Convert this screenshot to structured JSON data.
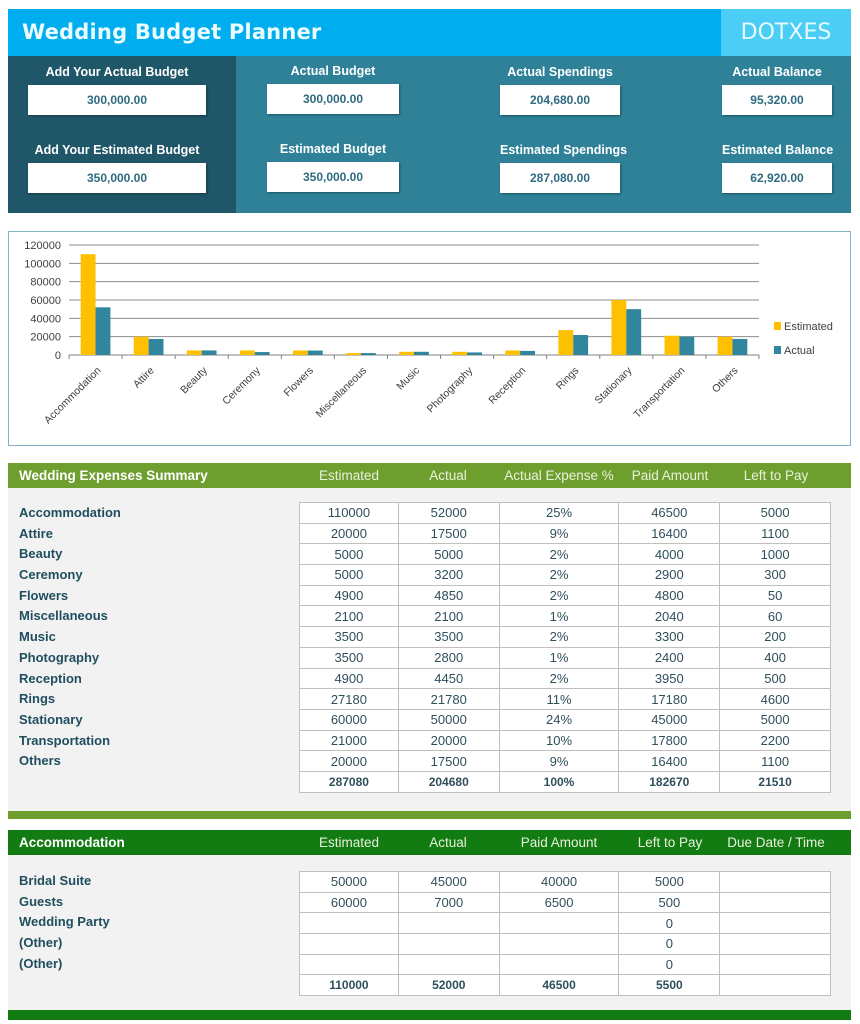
{
  "header": {
    "title": "Wedding Budget Planner",
    "brand": "DOTXES",
    "colors": {
      "title_bg": "#00aeef",
      "brand_bg": "#4ccdf5",
      "kpi_bg": "#2e8197",
      "input_bg": "#1f5668"
    }
  },
  "inputs": {
    "actual_budget_label": "Add Your Actual Budget",
    "actual_budget_value": "300,000.00",
    "estimated_budget_label": "Add Your Estimated Budget",
    "estimated_budget_value": "350,000.00"
  },
  "kpis": [
    {
      "label": "Actual Budget",
      "value": "300,000.00"
    },
    {
      "label": "Estimated Budget",
      "value": "350,000.00"
    },
    {
      "label": "Actual Spendings",
      "value": "204,680.00"
    },
    {
      "label": "Estimated Spendings",
      "value": "287,080.00"
    },
    {
      "label": "Actual Balance",
      "value": "95,320.00"
    },
    {
      "label": "Estimated Balance",
      "value": "62,920.00"
    }
  ],
  "chart_data": {
    "type": "bar",
    "title": "",
    "xlabel": "",
    "ylabel": "",
    "categories": [
      "Accommodation",
      "Attire",
      "Beauty",
      "Ceremony",
      "Flowers",
      "Miscellaneous",
      "Music",
      "Photography",
      "Reception",
      "Rings",
      "Stationary",
      "Transportation",
      "Others"
    ],
    "series": [
      {
        "name": "Estimated",
        "color": "#ffc000",
        "values": [
          110000,
          20000,
          5000,
          5000,
          4900,
          2100,
          3500,
          3500,
          4900,
          27180,
          60000,
          21000,
          20000
        ]
      },
      {
        "name": "Actual",
        "color": "#31859c",
        "values": [
          52000,
          17500,
          5000,
          3200,
          4850,
          2100,
          3500,
          2800,
          4450,
          21780,
          50000,
          20000,
          17500
        ]
      }
    ],
    "ylim": [
      0,
      120000
    ],
    "yticks": [
      "0",
      "20000",
      "40000",
      "60000",
      "80000",
      "100000",
      "120000"
    ],
    "grid": true,
    "legend": "right"
  },
  "summary": {
    "title": "Wedding Expenses Summary",
    "header_color": "#6e9e2e",
    "columns": [
      "Estimated",
      "Actual",
      "Actual Expense %",
      "Paid Amount",
      "Left to Pay"
    ],
    "rows": [
      {
        "label": "Accommodation",
        "cells": [
          "110000",
          "52000",
          "25%",
          "46500",
          "5000"
        ]
      },
      {
        "label": "Attire",
        "cells": [
          "20000",
          "17500",
          "9%",
          "16400",
          "1100"
        ]
      },
      {
        "label": "Beauty",
        "cells": [
          "5000",
          "5000",
          "2%",
          "4000",
          "1000"
        ]
      },
      {
        "label": "Ceremony",
        "cells": [
          "5000",
          "3200",
          "2%",
          "2900",
          "300"
        ]
      },
      {
        "label": "Flowers",
        "cells": [
          "4900",
          "4850",
          "2%",
          "4800",
          "50"
        ]
      },
      {
        "label": "Miscellaneous",
        "cells": [
          "2100",
          "2100",
          "1%",
          "2040",
          "60"
        ]
      },
      {
        "label": "Music",
        "cells": [
          "3500",
          "3500",
          "2%",
          "3300",
          "200"
        ]
      },
      {
        "label": "Photography",
        "cells": [
          "3500",
          "2800",
          "1%",
          "2400",
          "400"
        ]
      },
      {
        "label": "Reception",
        "cells": [
          "4900",
          "4450",
          "2%",
          "3950",
          "500"
        ]
      },
      {
        "label": "Rings",
        "cells": [
          "27180",
          "21780",
          "11%",
          "17180",
          "4600"
        ]
      },
      {
        "label": "Stationary",
        "cells": [
          "60000",
          "50000",
          "24%",
          "45000",
          "5000"
        ]
      },
      {
        "label": "Transportation",
        "cells": [
          "21000",
          "20000",
          "10%",
          "17800",
          "2200"
        ]
      },
      {
        "label": "Others",
        "cells": [
          "20000",
          "17500",
          "9%",
          "16400",
          "1100"
        ]
      }
    ],
    "total": [
      "287080",
      "204680",
      "100%",
      "182670",
      "21510"
    ]
  },
  "accommodation": {
    "title": "Accommodation",
    "header_color": "#127b12",
    "columns": [
      "Estimated",
      "Actual",
      "Paid Amount",
      "Left to Pay",
      "Due Date / Time"
    ],
    "rows": [
      {
        "label": "Bridal Suite",
        "cells": [
          "50000",
          "45000",
          "40000",
          "5000",
          ""
        ]
      },
      {
        "label": "Guests",
        "cells": [
          "60000",
          "7000",
          "6500",
          "500",
          ""
        ]
      },
      {
        "label": "Wedding Party",
        "cells": [
          "",
          "",
          "",
          "0",
          ""
        ]
      },
      {
        "label": "(Other)",
        "cells": [
          "",
          "",
          "",
          "0",
          ""
        ]
      },
      {
        "label": "(Other)",
        "cells": [
          "",
          "",
          "",
          "0",
          ""
        ]
      }
    ],
    "total": [
      "110000",
      "52000",
      "46500",
      "5500",
      ""
    ]
  }
}
